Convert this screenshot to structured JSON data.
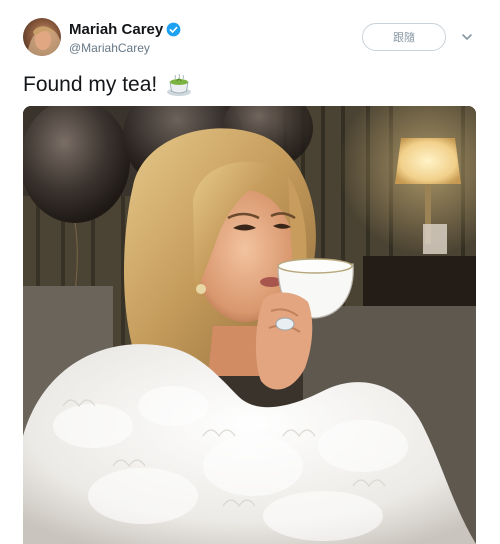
{
  "tweet": {
    "display_name": "Mariah Carey",
    "handle": "@MariahCarey",
    "verified": true,
    "follow_button_label": "跟隨",
    "text": "Found my tea!",
    "emoji": "tea-cup-emoji",
    "photo_alt": "photo"
  },
  "colors": {
    "verified": "#1da1f2",
    "text": "#14171a",
    "secondary": "#657786"
  }
}
